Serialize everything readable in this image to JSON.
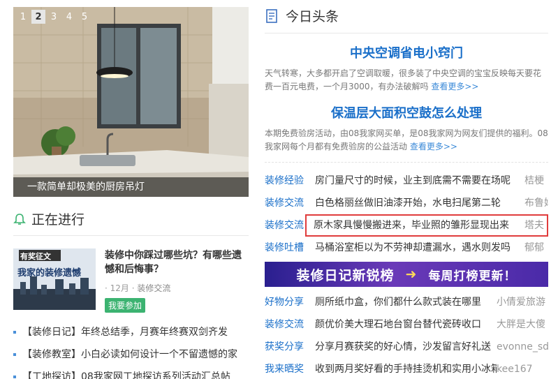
{
  "slider": {
    "dots": [
      "1",
      "2",
      "3",
      "4",
      "5"
    ],
    "active": 1,
    "caption": "一款简单却极美的厨房吊灯"
  },
  "ongoing": {
    "title": "正在进行",
    "feature": {
      "badge": "有奖征文",
      "thumb_text": "我家的装修遗憾",
      "title": "装修中你踩过哪些坑？有哪些遗憾和后悔事？",
      "date": "12月",
      "category": "装修交流",
      "join": "我要参加"
    },
    "bullets": [
      "【装修日记】年终总结季，月赛年终赛双剑齐发",
      "【装修教室】小白必读如何设计一个不留遗憾的家",
      "【工地探访】08我家网工地探访系列活动汇总帖"
    ]
  },
  "headlines": {
    "title": "今日头条",
    "items": [
      {
        "title": "中央空调省电小窍门",
        "summary": "天气转寒，大多都开启了空调取暖，很多装了中央空调的宝宝反映每天要花费一百元电费，一个月3000，有办法破解吗",
        "more": "查看更多>>"
      },
      {
        "title": "保温层大面积空鼓怎么处理",
        "summary": "本期免费验房活动，由08我家网买单，是08我家网为网友们提供的福利。08我家网每个月都有免费验房的公益活动",
        "more": "查看更多>>"
      }
    ],
    "news1": [
      {
        "cat": "装修经验",
        "text": "房门量尺寸的时候，业主到底需不需要在场呢",
        "author": "桔梗"
      },
      {
        "cat": "装修交流",
        "text": "白色格丽丝做旧油漆开始，水电扫尾第二轮",
        "author": "布鲁妈"
      },
      {
        "cat": "装修交流",
        "text": "原木家具慢慢搬进来，毕业照的雏形显现出来",
        "author": "塔夫"
      },
      {
        "cat": "装修吐槽",
        "text": "马桶浴室柜以为不劳神却遭漏水，遇水则发吗",
        "author": "郁郁"
      }
    ],
    "banner": {
      "left": "装修日记新锐榜",
      "right": "每周打榜更新！"
    },
    "news2": [
      {
        "cat": "好物分享",
        "text": "厕所纸巾盒，你们都什么款式装在哪里",
        "author": "小倩爱旅游"
      },
      {
        "cat": "装修交流",
        "text": "颜优价美大理石地台窗台替代瓷砖收口",
        "author": "大胖是大傻"
      },
      {
        "cat": "获奖分享",
        "text": "分享月赛获奖的好心情，沙发留言好礼送",
        "author": "evonne_sd"
      },
      {
        "cat": "我来晒奖",
        "text": "收到两月奖好看的手持挂烫机和实用小冰箱",
        "author": "kee167"
      }
    ]
  }
}
